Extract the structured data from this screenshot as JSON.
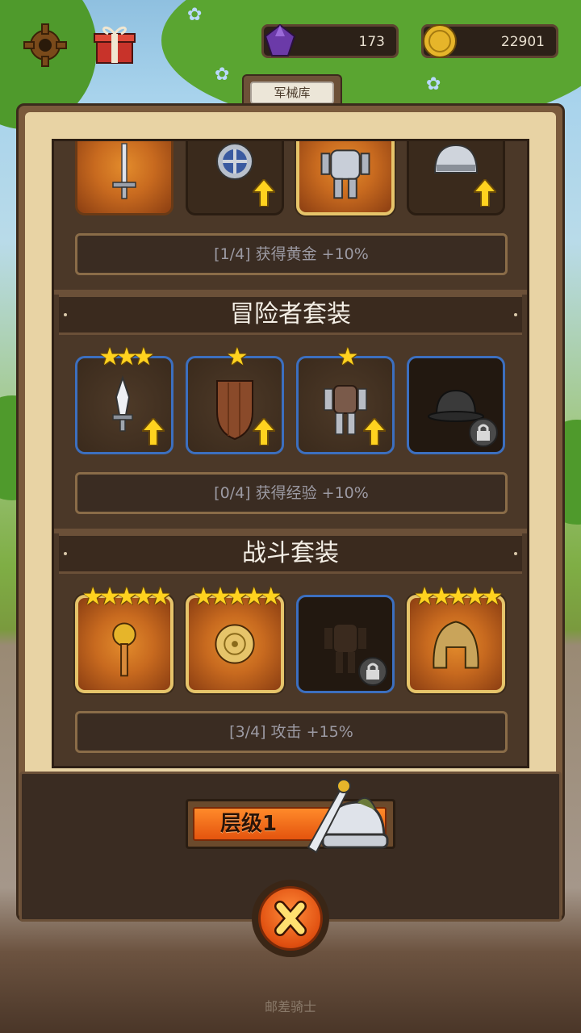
{
  "resources": {
    "gems": "173",
    "gold": "22901"
  },
  "tab_label": "军械库",
  "sets": [
    {
      "bonus": "[1/4] 获得黄金 +10%"
    },
    {
      "title": "冒险者套装",
      "bonus": "[0/4] 获得经验 +10%",
      "stars": [
        "★★★",
        "★",
        "★",
        ""
      ]
    },
    {
      "title": "战斗套装",
      "bonus": "[3/4] 攻击 +15%",
      "stars": [
        "★★★★★",
        "★★★★★",
        "",
        "★★★★★"
      ]
    }
  ],
  "level_label": "层级1",
  "footer_text": "邮差骑士",
  "icons": [
    "gear-icon",
    "gift-icon",
    "gem-icon",
    "gold-coin-icon",
    "upgrade-arrow-icon",
    "lock-icon",
    "close-icon",
    "star-icon"
  ],
  "colors": {
    "accent": "#e4540e",
    "star": "#ffd21f",
    "slot_border_blue": "#3c6fbf",
    "slot_border_gold": "#e6c46a"
  }
}
